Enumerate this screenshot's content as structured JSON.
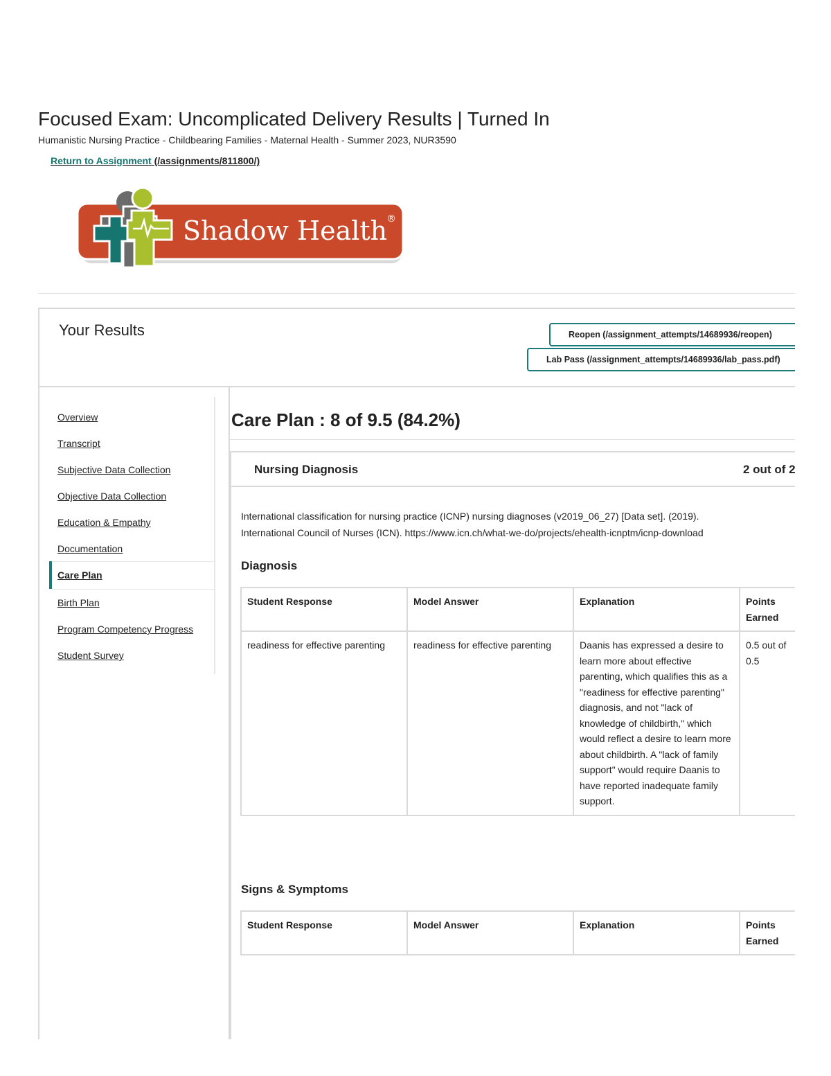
{
  "header": {
    "title": "Focused Exam: Uncomplicated Delivery Results | Turned In",
    "course": "Humanistic Nursing Practice - Childbearing Families - Maternal Health - Summer 2023, NUR3590",
    "return_label": "Return to Assignment",
    "return_href": "(/assignments/811800/)"
  },
  "logo": {
    "text": "Shadow Health",
    "registered": "®",
    "colors": {
      "orange": "#c9492a",
      "gray": "#6b6b6b",
      "green": "#a9bf2e",
      "teal": "#17756f"
    }
  },
  "results": {
    "title": "Your Results",
    "reopen_button": "Reopen (/assignment_attempts/14689936/reopen)",
    "labpass_button": "Lab Pass (/assignment_attempts/14689936/lab_pass.pdf)"
  },
  "sidebar": {
    "items": [
      {
        "label": "Overview"
      },
      {
        "label": "Transcript"
      },
      {
        "label": "Subjective Data Collection"
      },
      {
        "label": "Objective Data Collection"
      },
      {
        "label": "Education & Empathy"
      },
      {
        "label": "Documentation"
      },
      {
        "label": "Care Plan"
      },
      {
        "label": "Birth Plan"
      },
      {
        "label": "Program Competency Progress"
      },
      {
        "label": "Student Survey"
      }
    ],
    "active_index": 6
  },
  "main": {
    "section_title": "Care Plan : 8 of 9.5 (84.2%)",
    "card": {
      "title": "Nursing Diagnosis",
      "score": "2 out of 2",
      "citation_1": "International classification for nursing practice (ICNP) nursing diagnoses (v2019_06_27) [Data set]. (2019).",
      "citation_2": "International Council of Nurses (ICN). https://www.icn.ch/what-we-do/projects/ehealth-icnptm/icnp-download",
      "diagnosis": {
        "title": "Diagnosis",
        "headers": [
          "Student Response",
          "Model Answer",
          "Explanation",
          "Points Earned"
        ],
        "rows": [
          {
            "student": "readiness for effective parenting",
            "model": "readiness for effective parenting",
            "explanation": "Daanis has expressed a desire to learn more about effective parenting, which qualifies this as a \"readiness for effective parenting\" diagnosis, and not \"lack of knowledge of childbirth,\" which would reflect a desire to learn more about childbirth. A \"lack of family support\" would require Daanis to have reported inadequate family support.",
            "points": "0.5 out of 0.5"
          }
        ]
      },
      "signs": {
        "title": "Signs & Symptoms",
        "headers": [
          "Student Response",
          "Model Answer",
          "Explanation",
          "Points Earned"
        ]
      }
    }
  }
}
